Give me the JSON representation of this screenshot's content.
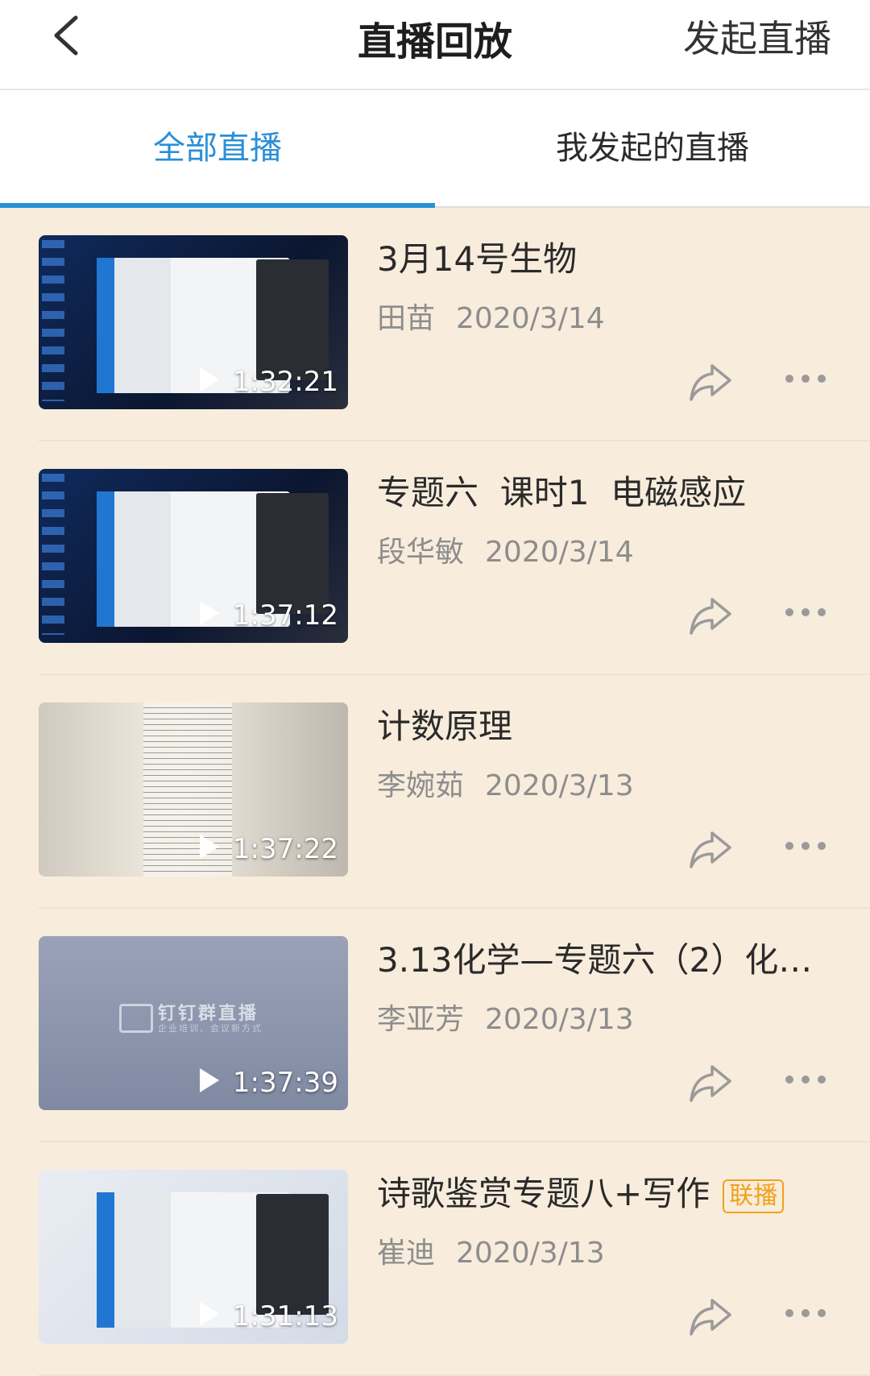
{
  "header": {
    "title": "直播回放",
    "start_live_label": "发起直播"
  },
  "tabs": [
    {
      "label": "全部直播",
      "active": true
    },
    {
      "label": "我发起的直播",
      "active": false
    }
  ],
  "colors": {
    "accent": "#2a8fd7",
    "badge": "#f0a21a",
    "list_background": "#f8ecdc"
  },
  "items": [
    {
      "title": "3月14号生物",
      "author": "田苗",
      "date": "2020/3/14",
      "duration": "1:32:21",
      "badge": ""
    },
    {
      "title": "专题六  课时1  电磁感应",
      "author": "段华敏",
      "date": "2020/3/14",
      "duration": "1:37:12",
      "badge": ""
    },
    {
      "title": "计数原理",
      "author": "李婉茹",
      "date": "2020/3/13",
      "duration": "1:37:22",
      "badge": ""
    },
    {
      "title": "3.13化学—专题六（2）化…",
      "author": "李亚芳",
      "date": "2020/3/13",
      "duration": "1:37:39",
      "badge": "",
      "thumb_brand": "钉钉群直播",
      "thumb_sub": "企业培训、会议新方式"
    },
    {
      "title": "诗歌鉴赏专题八+写作",
      "author": "崔迪",
      "date": "2020/3/13",
      "duration": "1:31:13",
      "badge": "联播"
    }
  ]
}
